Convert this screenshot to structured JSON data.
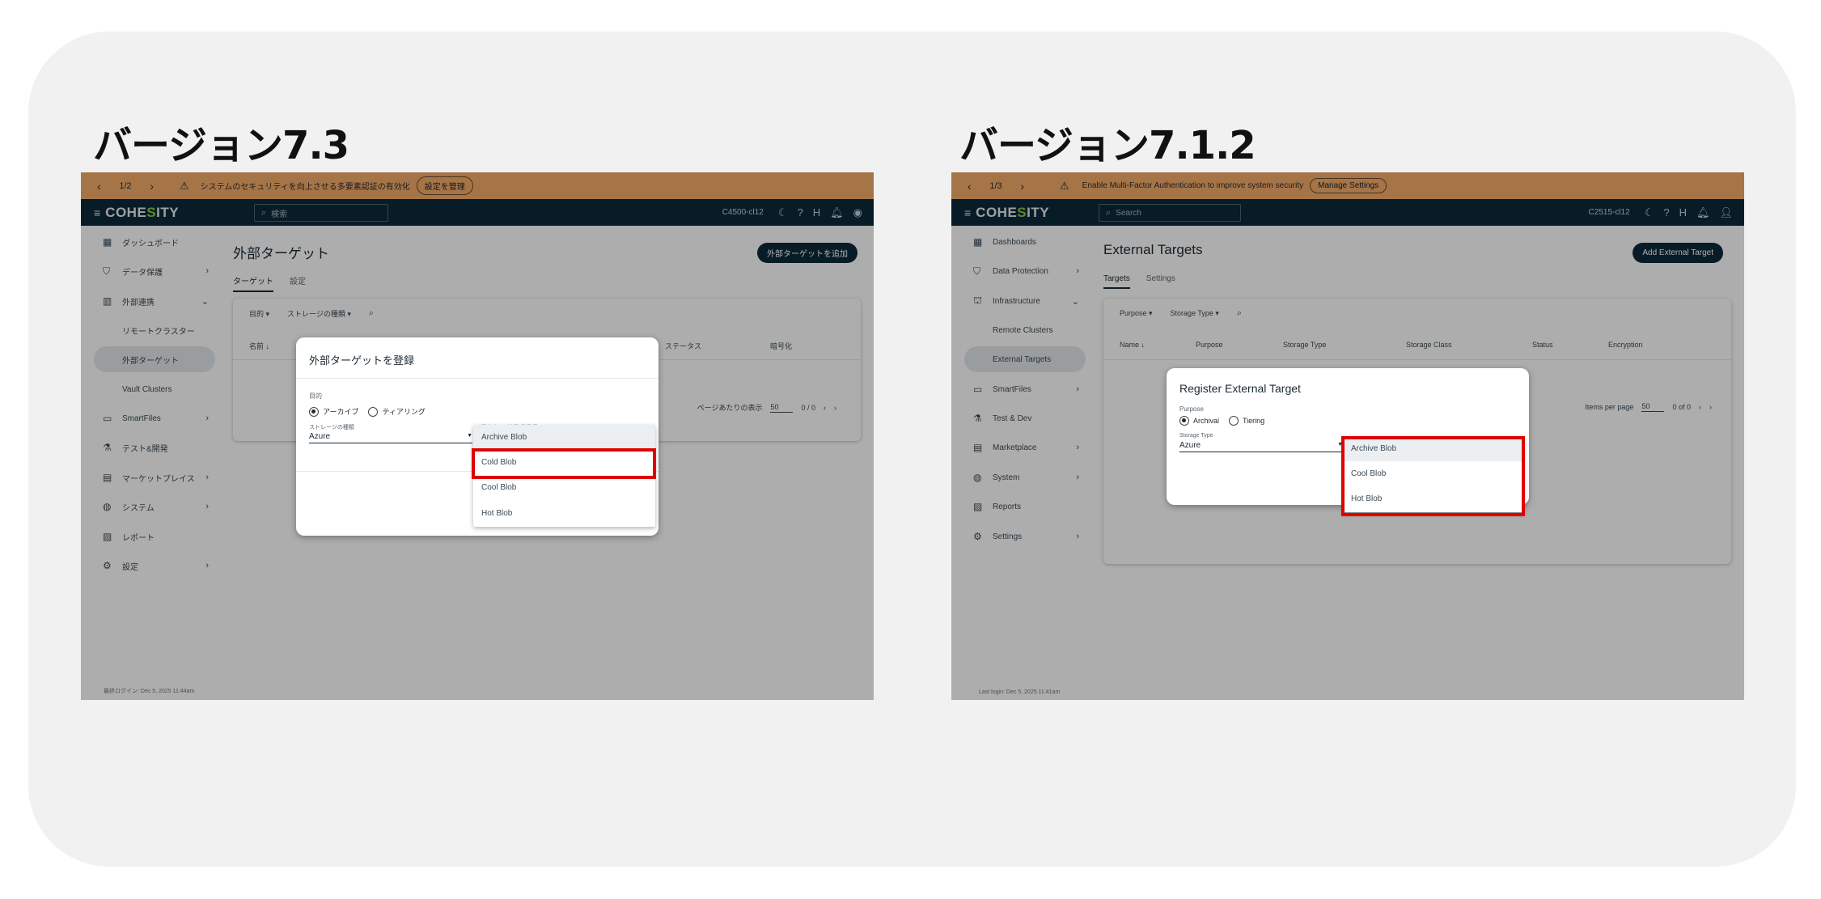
{
  "left": {
    "version_title": "バージョン7.3",
    "banner": {
      "page": "1/2",
      "message": "システムのセキュリティを向上させる多要素認証の有効化",
      "button": "設定を管理"
    },
    "topbar": {
      "logo_pre": "COHE",
      "logo_mid": "S",
      "logo_post": "ITY",
      "search_placeholder": "検索",
      "cluster": "C4500-cl12"
    },
    "nav": [
      {
        "label": "ダッシュボード",
        "icon": "▦"
      },
      {
        "label": "データ保護",
        "icon": "⛉"
      },
      {
        "label": "外部連携",
        "icon": "▥"
      },
      {
        "label": "リモートクラスター"
      },
      {
        "label": "外部ターゲット"
      },
      {
        "label": "Vault Clusters"
      },
      {
        "label": "SmartFiles",
        "icon": "▭"
      },
      {
        "label": "テスト&開発",
        "icon": "⚗"
      },
      {
        "label": "マーケットプレイス",
        "icon": "▤"
      },
      {
        "label": "システム",
        "icon": "◍"
      },
      {
        "label": "レポート",
        "icon": "▨"
      },
      {
        "label": "設定",
        "icon": "⚙"
      }
    ],
    "footer": "最終ログイン: Dec 5, 2025 11:44am",
    "page_title": "外部ターゲット",
    "add_button": "外部ターゲットを追加",
    "tabs": [
      "ターゲット",
      "設定"
    ],
    "filters": [
      "目的 ▾",
      "ストレージの種類 ▾"
    ],
    "columns": [
      "名前 ↓",
      "ステータス",
      "暗号化"
    ],
    "pager": {
      "per_page_label": "ページあたりの表示",
      "per_page": "50",
      "count": "0 / 0"
    },
    "dialog": {
      "title": "外部ターゲットを登録",
      "purpose_label": "目的",
      "radio_archive": "アーカイブ",
      "radio_tiering": "ティアリング",
      "storage_type_label": "ストレージの種類",
      "storage_type_value": "Azure",
      "storage_class_ghost": "ストレージのクラス"
    },
    "dropdown": [
      "Archive Blob",
      "Cold Blob",
      "Cool Blob",
      "Hot Blob"
    ]
  },
  "right": {
    "version_title": "バージョン7.1.2",
    "banner": {
      "page": "1/3",
      "message": "Enable Multi-Factor Authentication to improve system security",
      "button": "Manage Settings"
    },
    "topbar": {
      "logo_pre": "COHE",
      "logo_mid": "S",
      "logo_post": "ITY",
      "search_placeholder": "Search",
      "cluster": "C2515-cl12"
    },
    "nav": [
      {
        "label": "Dashboards",
        "icon": "▦"
      },
      {
        "label": "Data Protection",
        "icon": "⛉"
      },
      {
        "label": "Infrastructure",
        "icon": "⛫"
      },
      {
        "label": "Remote Clusters"
      },
      {
        "label": "External Targets"
      },
      {
        "label": "SmartFiles",
        "icon": "▭"
      },
      {
        "label": "Test & Dev",
        "icon": "⚗"
      },
      {
        "label": "Marketplace",
        "icon": "▤"
      },
      {
        "label": "System",
        "icon": "◍"
      },
      {
        "label": "Reports",
        "icon": "▨"
      },
      {
        "label": "Settings",
        "icon": "⚙"
      }
    ],
    "footer": "Last login: Dec 5, 2025 11:41am",
    "page_title": "External Targets",
    "add_button": "Add External Target",
    "tabs": [
      "Targets",
      "Settings"
    ],
    "filters": [
      "Purpose ▾",
      "Storage Type ▾"
    ],
    "columns": [
      "Name ↓",
      "Purpose",
      "Storage Type",
      "Storage Class",
      "Status",
      "Encryption"
    ],
    "pager": {
      "per_page_label": "Items per page",
      "per_page": "50",
      "count": "0 of 0"
    },
    "dialog": {
      "title": "Register External Target",
      "purpose_label": "Purpose",
      "radio_archive": "Archival",
      "radio_tiering": "Tiering",
      "storage_type_label": "Storage Type",
      "storage_type_value": "Azure"
    },
    "dropdown": [
      "Archive Blob",
      "Cool Blob",
      "Hot Blob"
    ]
  },
  "colors": {
    "banner": "#f3ad6a",
    "topbar": "#0d2a3c",
    "highlight": "#e00000",
    "card": "#f1f1f1"
  }
}
